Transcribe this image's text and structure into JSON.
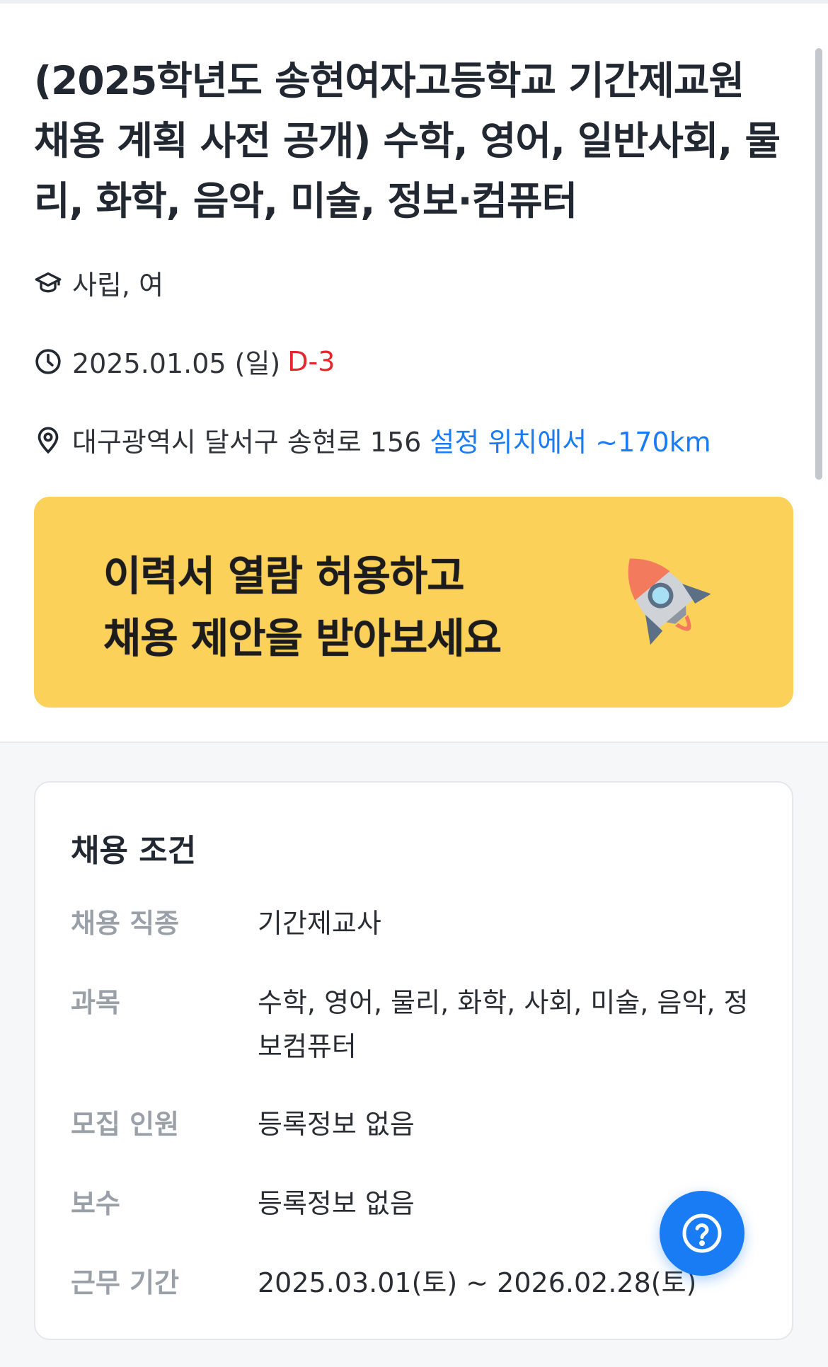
{
  "posting": {
    "title": "(2025학년도 송현여자고등학교 기간제교원 채용 계획 사전 공개) 수학, 영어, 일반사회, 물리, 화학, 음악, 미술, 정보·컴퓨터",
    "school_type": "사립, 여",
    "deadline": "2025.01.05 (일)",
    "d_day": "D-3",
    "address": "대구광역시 달서구 송현로 156",
    "distance": "설정 위치에서 ~170km"
  },
  "banner": {
    "line1": "이력서 열람 허용하고",
    "line2": "채용 제안을 받아보세요",
    "icon": "rocket-icon"
  },
  "conditions": {
    "title": "채용 조건",
    "rows": [
      {
        "label": "채용 직종",
        "value": "기간제교사"
      },
      {
        "label": "과목",
        "value": "수학, 영어, 물리, 화학, 사회, 미술, 음악, 정보컴퓨터"
      },
      {
        "label": "모집 인원",
        "value": "등록정보 없음"
      },
      {
        "label": "보수",
        "value": "등록정보 없음"
      },
      {
        "label": "근무 기간",
        "value": "2025.03.01(토) ~ 2026.02.28(토)"
      }
    ]
  },
  "colors": {
    "d_day": "#e5262c",
    "distance": "#1a7cf5",
    "banner_bg": "#fcd15a",
    "fab_bg": "#1a7cf5"
  },
  "fab": {
    "icon": "question-circle-icon"
  }
}
